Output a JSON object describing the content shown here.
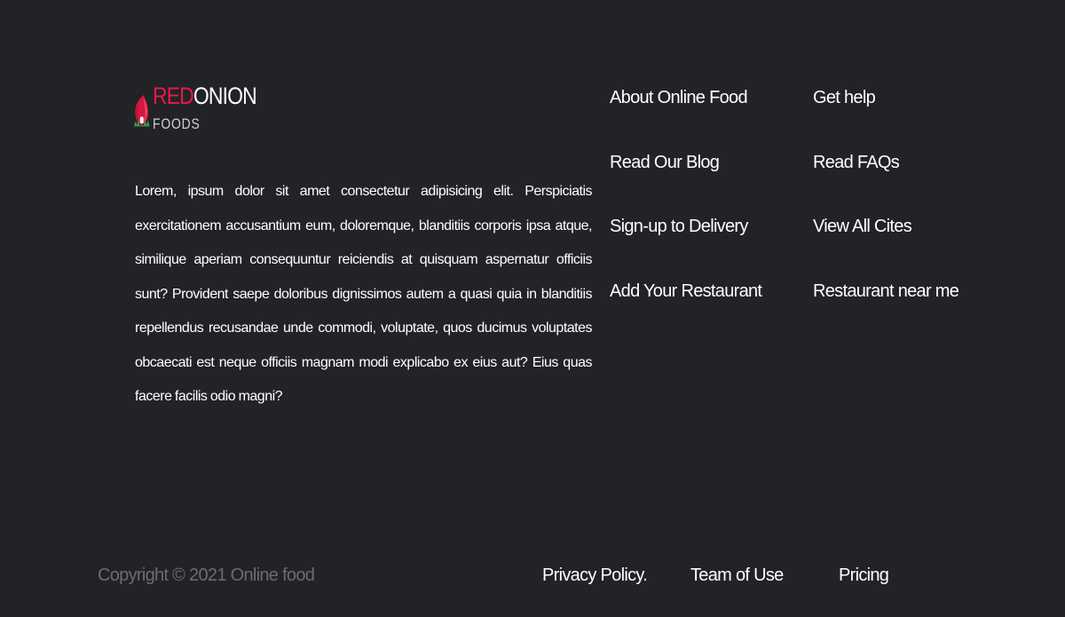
{
  "brand": {
    "name_red": "RED",
    "name_white": "ONION",
    "subtitle": "FOODS",
    "accent_color": "#e6194b",
    "logo_icon": "onion-house-icon"
  },
  "description": "Lorem, ipsum dolor sit amet consectetur adipisicing elit. Perspiciatis exercitationem accusantium eum, doloremque, blanditiis corporis ipsa atque, similique aperiam consequuntur reiciendis at quisquam aspernatur officiis sunt? Provident saepe doloribus dignissimos autem a quasi quia in blanditiis repellendus recusandae unde commodi, voluptate, quos ducimus voluptates obcaecati est neque officiis magnam modi explicabo ex eius aut? Eius quas facere facilis odio magni?",
  "links": {
    "column1": [
      "About Online Food",
      "Read Our Blog",
      "Sign-up to Delivery",
      "Add Your Restaurant"
    ],
    "column2": [
      "Get help",
      "Read FAQs",
      "View All Cites",
      "Restaurant near me"
    ]
  },
  "bottom": {
    "copyright": "Copyright © 2021 Online food",
    "privacy": "Privacy Policy.",
    "team": "Team of Use",
    "pricing": "Pricing"
  },
  "colors": {
    "background": "#212327",
    "text": "#ffffff",
    "muted": "#6c6c6f"
  }
}
